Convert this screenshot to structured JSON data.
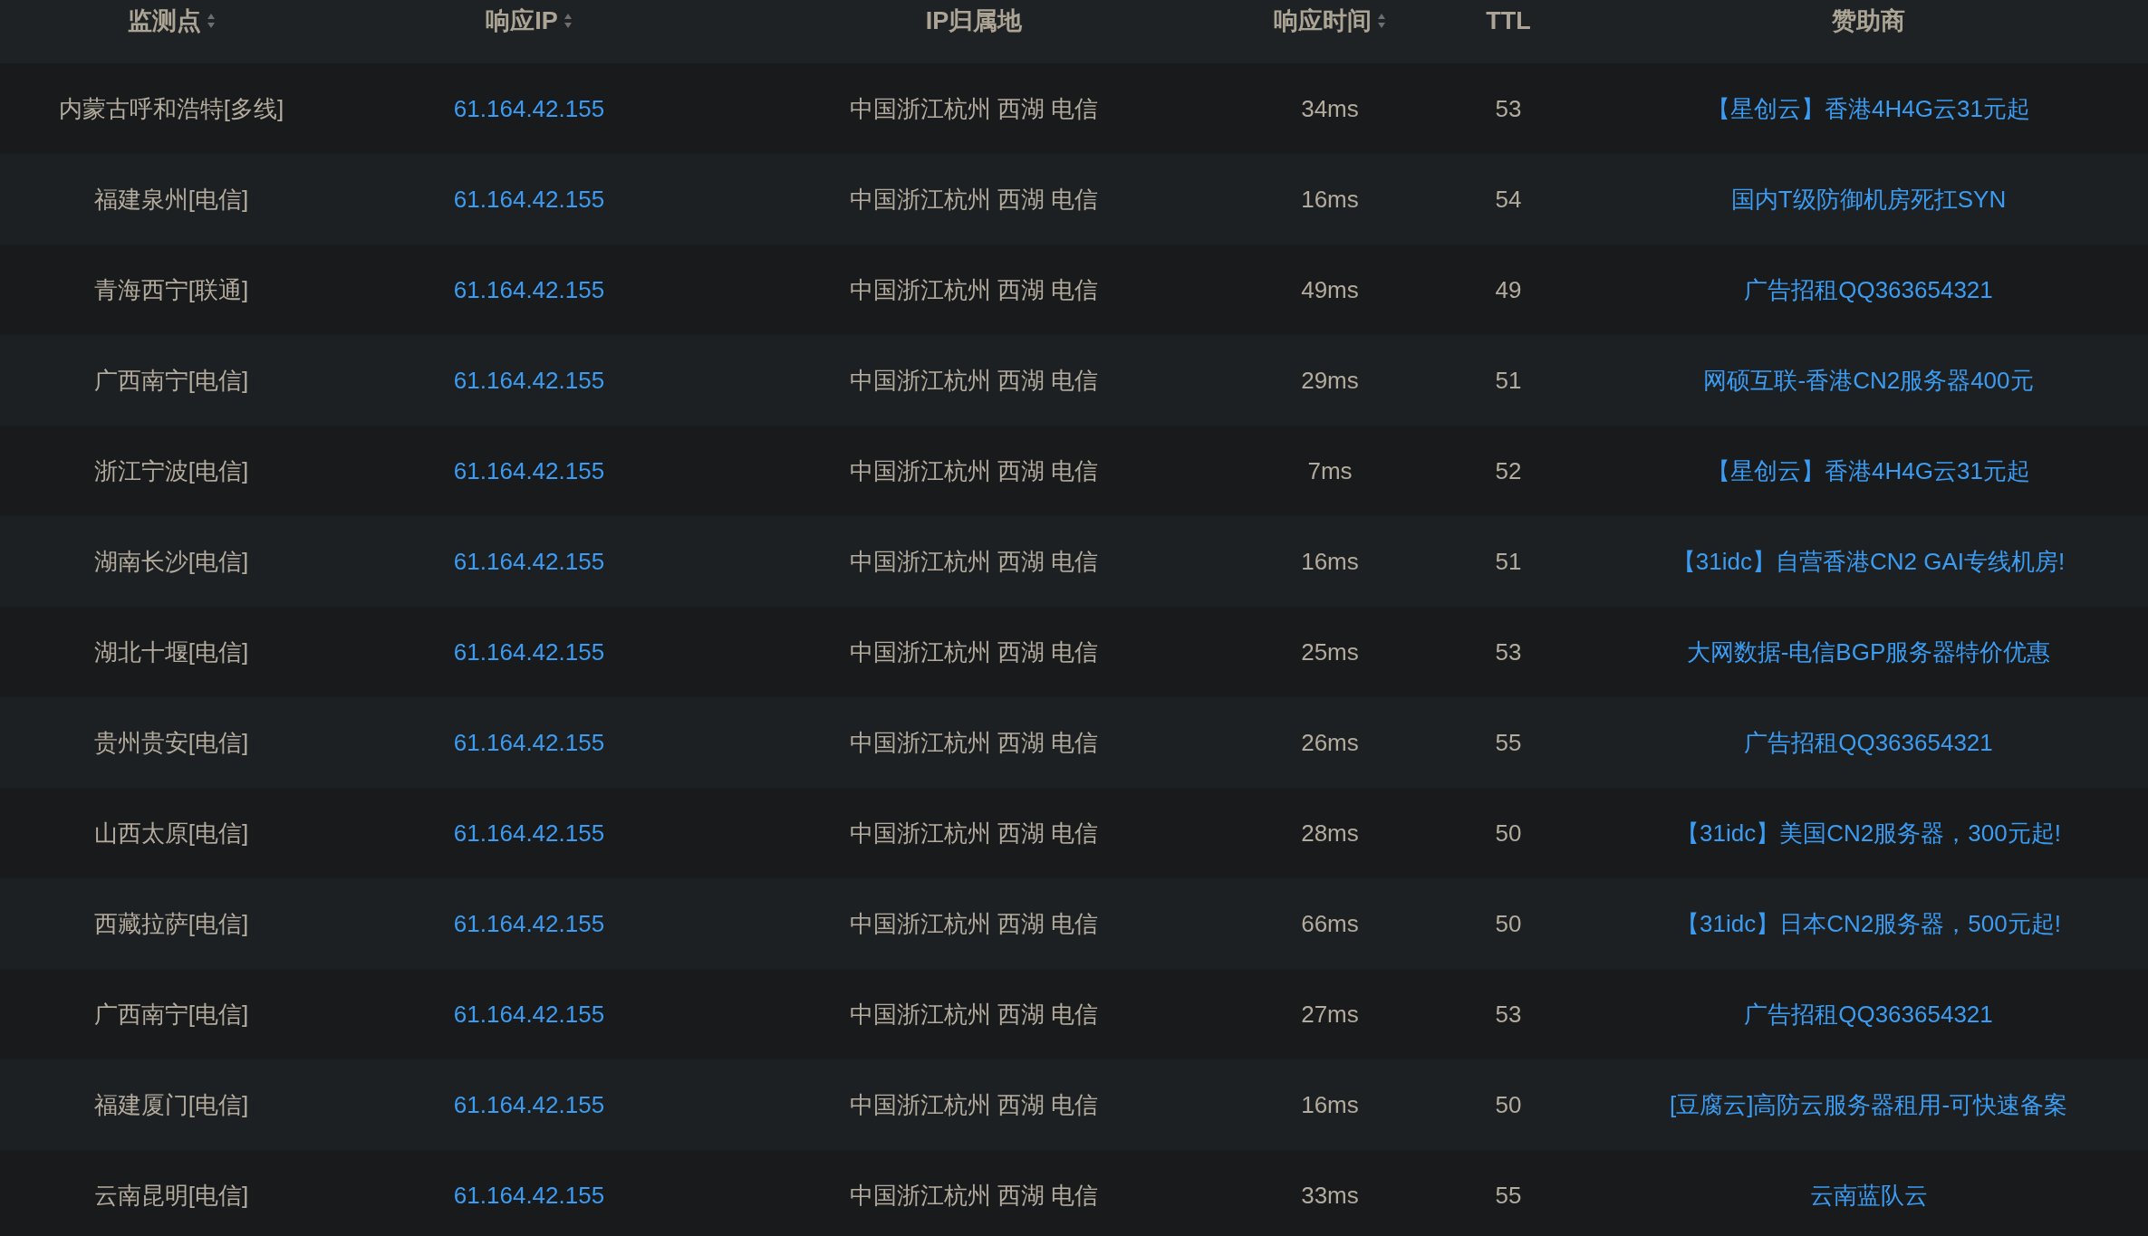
{
  "table": {
    "columns": [
      {
        "label": "监测点",
        "sortable": true
      },
      {
        "label": "响应IP",
        "sortable": true
      },
      {
        "label": "IP归属地",
        "sortable": false
      },
      {
        "label": "响应时间",
        "sortable": true
      },
      {
        "label": "TTL",
        "sortable": false
      },
      {
        "label": "赞助商",
        "sortable": false
      }
    ],
    "rows": [
      {
        "node": "内蒙古呼和浩特[多线]",
        "ip": "61.164.42.155",
        "location": "中国浙江杭州 西湖 电信",
        "time": "34ms",
        "ttl": "53",
        "sponsor": "【星创云】香港4H4G云31元起"
      },
      {
        "node": "福建泉州[电信]",
        "ip": "61.164.42.155",
        "location": "中国浙江杭州 西湖 电信",
        "time": "16ms",
        "ttl": "54",
        "sponsor": "国内T级防御机房死扛SYN"
      },
      {
        "node": "青海西宁[联通]",
        "ip": "61.164.42.155",
        "location": "中国浙江杭州 西湖 电信",
        "time": "49ms",
        "ttl": "49",
        "sponsor": "广告招租QQ363654321"
      },
      {
        "node": "广西南宁[电信]",
        "ip": "61.164.42.155",
        "location": "中国浙江杭州 西湖 电信",
        "time": "29ms",
        "ttl": "51",
        "sponsor": "网硕互联-香港CN2服务器400元"
      },
      {
        "node": "浙江宁波[电信]",
        "ip": "61.164.42.155",
        "location": "中国浙江杭州 西湖 电信",
        "time": "7ms",
        "ttl": "52",
        "sponsor": "【星创云】香港4H4G云31元起"
      },
      {
        "node": "湖南长沙[电信]",
        "ip": "61.164.42.155",
        "location": "中国浙江杭州 西湖 电信",
        "time": "16ms",
        "ttl": "51",
        "sponsor": "【31idc】自营香港CN2 GAI专线机房!"
      },
      {
        "node": "湖北十堰[电信]",
        "ip": "61.164.42.155",
        "location": "中国浙江杭州 西湖 电信",
        "time": "25ms",
        "ttl": "53",
        "sponsor": "大网数据-电信BGP服务器特价优惠"
      },
      {
        "node": "贵州贵安[电信]",
        "ip": "61.164.42.155",
        "location": "中国浙江杭州 西湖 电信",
        "time": "26ms",
        "ttl": "55",
        "sponsor": "广告招租QQ363654321"
      },
      {
        "node": "山西太原[电信]",
        "ip": "61.164.42.155",
        "location": "中国浙江杭州 西湖 电信",
        "time": "28ms",
        "ttl": "50",
        "sponsor": "【31idc】美国CN2服务器，300元起!"
      },
      {
        "node": "西藏拉萨[电信]",
        "ip": "61.164.42.155",
        "location": "中国浙江杭州 西湖 电信",
        "time": "66ms",
        "ttl": "50",
        "sponsor": "【31idc】日本CN2服务器，500元起!"
      },
      {
        "node": "广西南宁[电信]",
        "ip": "61.164.42.155",
        "location": "中国浙江杭州 西湖 电信",
        "time": "27ms",
        "ttl": "53",
        "sponsor": "广告招租QQ363654321"
      },
      {
        "node": "福建厦门[电信]",
        "ip": "61.164.42.155",
        "location": "中国浙江杭州 西湖 电信",
        "time": "16ms",
        "ttl": "50",
        "sponsor": "[豆腐云]高防云服务器租用-可快速备案"
      },
      {
        "node": "云南昆明[电信]",
        "ip": "61.164.42.155",
        "location": "中国浙江杭州 西湖 电信",
        "time": "33ms",
        "ttl": "55",
        "sponsor": "云南蓝队云"
      }
    ]
  }
}
